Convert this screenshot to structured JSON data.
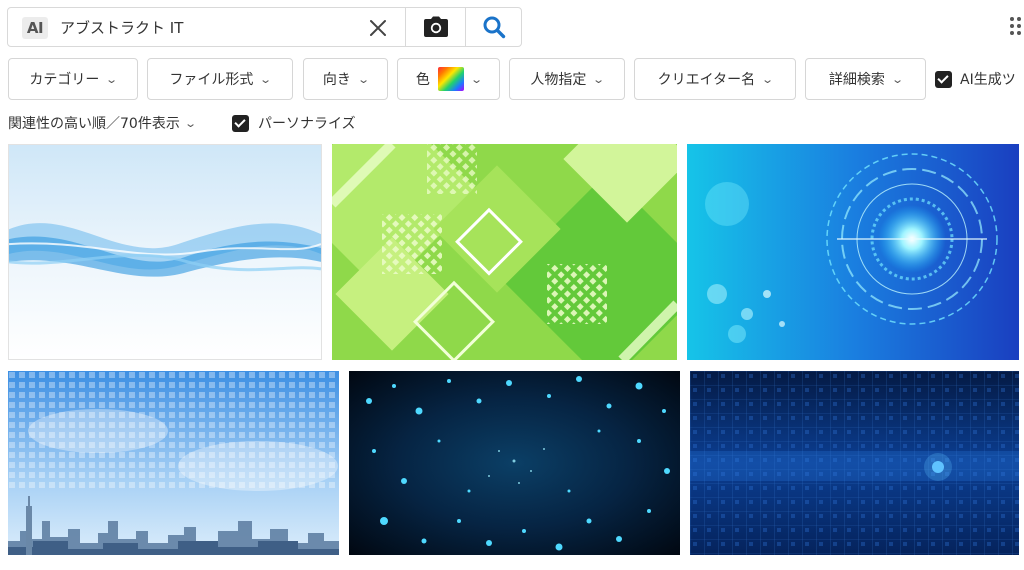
{
  "search": {
    "ai_badge": "AI",
    "query": "アブストラクト IT"
  },
  "icons": {
    "clear": "close-icon",
    "camera": "camera-icon",
    "search": "search-icon",
    "more": "more-vertical-icon"
  },
  "filters": [
    {
      "label": "カテゴリー"
    },
    {
      "label": "ファイル形式"
    },
    {
      "label": "向き"
    },
    {
      "label": "色"
    },
    {
      "label": "人物指定"
    },
    {
      "label": "クリエイター名"
    },
    {
      "label": "詳細検索"
    }
  ],
  "ai_filter": {
    "label": "AI生成ツ",
    "checked": true
  },
  "sort": {
    "label": "関連性の高い順／70件表示"
  },
  "personalize": {
    "label": "パーソナライズ",
    "checked": true
  },
  "colors": {
    "accent": "#1a73c9",
    "checkbox": "#222222",
    "border": "#d6d6d6"
  },
  "results": [
    {
      "theme": "light-blue-wave"
    },
    {
      "theme": "green-geometric"
    },
    {
      "theme": "blue-cyber-circle"
    },
    {
      "theme": "city-sky-digital"
    },
    {
      "theme": "dark-particle-burst"
    },
    {
      "theme": "blue-digital-grid"
    }
  ]
}
